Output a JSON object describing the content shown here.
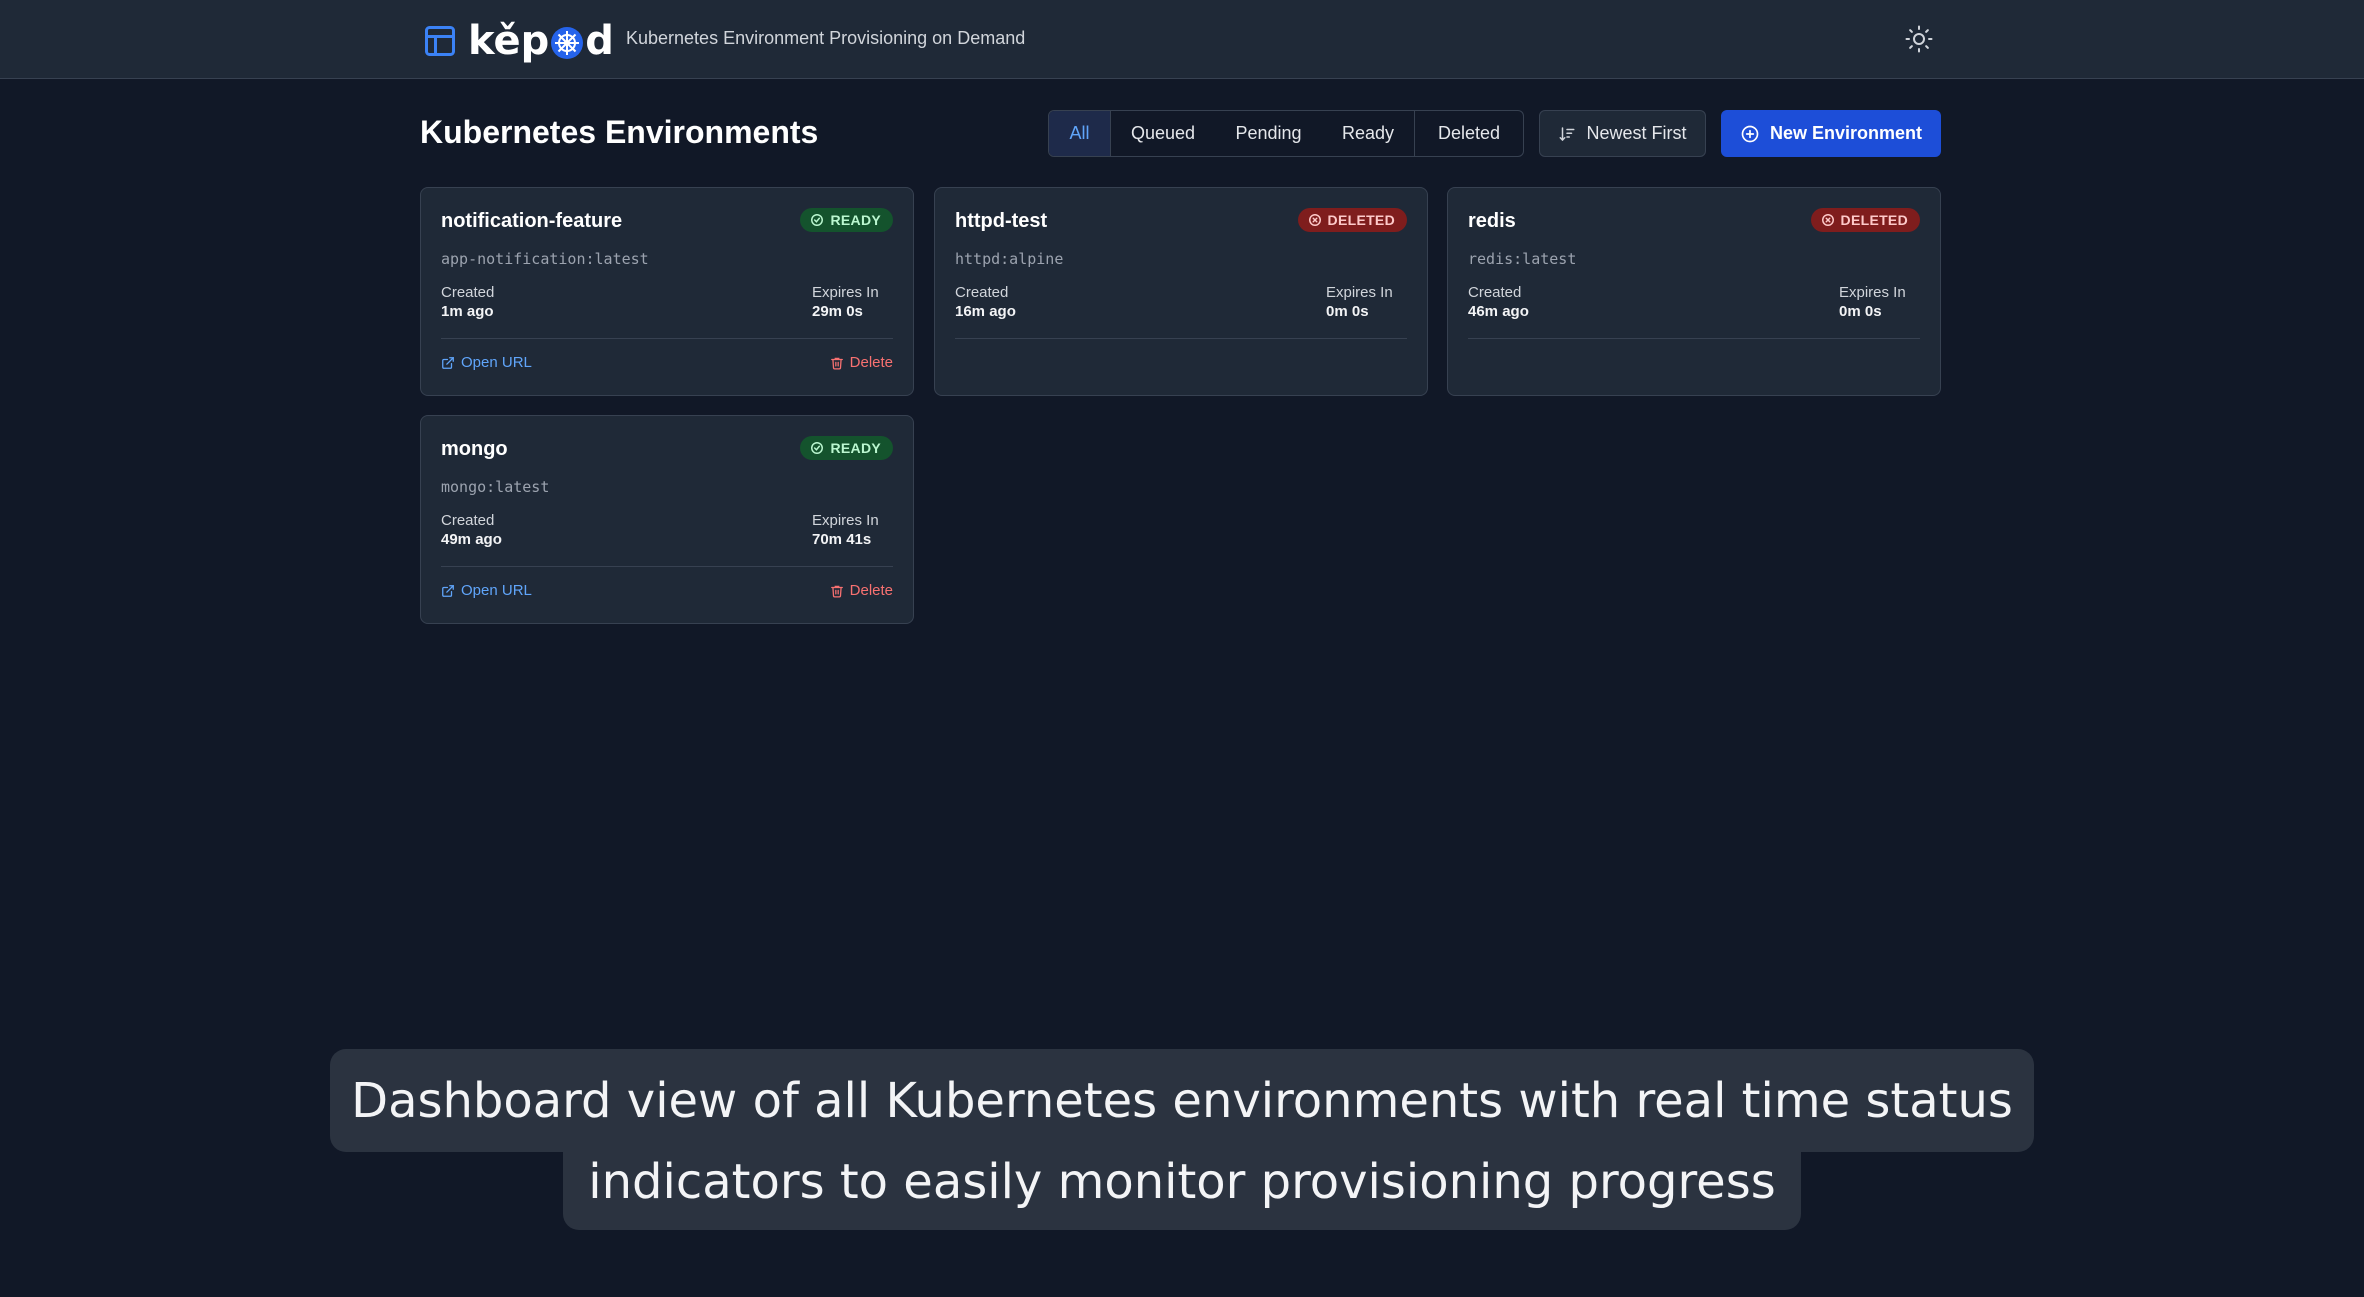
{
  "header": {
    "brand_name_start": "kěp",
    "brand_name_end": "d",
    "tagline": "Kubernetes Environment Provisioning on Demand",
    "logo_icon": "layout-icon",
    "theme_icon": "sun-icon"
  },
  "toolbar": {
    "title": "Kubernetes Environments",
    "filters": [
      {
        "label": "All",
        "active": true
      },
      {
        "label": "Queued",
        "active": false
      },
      {
        "label": "Pending",
        "active": false
      },
      {
        "label": "Ready",
        "active": false
      },
      {
        "label": "Deleted",
        "active": false
      }
    ],
    "sort_label": "Newest First",
    "new_label": "New Environment"
  },
  "labels": {
    "created": "Created",
    "expires": "Expires In",
    "open_url": "Open URL",
    "delete": "Delete"
  },
  "environments": [
    {
      "name": "notification-feature",
      "image": "app-notification:latest",
      "status": "READY",
      "created": "1m ago",
      "expires": "29m 0s"
    },
    {
      "name": "httpd-test",
      "image": "httpd:alpine",
      "status": "DELETED",
      "created": "16m ago",
      "expires": "0m 0s"
    },
    {
      "name": "redis",
      "image": "redis:latest",
      "status": "DELETED",
      "created": "46m ago",
      "expires": "0m 0s"
    },
    {
      "name": "mongo",
      "image": "mongo:latest",
      "status": "READY",
      "created": "49m ago",
      "expires": "70m 41s"
    }
  ],
  "caption": {
    "line1": "Dashboard view of all Kubernetes environments with real time status",
    "line2": "indicators to easily monitor provisioning progress"
  },
  "colors": {
    "background": "#111827",
    "surface": "#1f2937",
    "accent": "#1d4ed8",
    "link": "#60a5fa",
    "ready": "#14532d",
    "deleted": "#7f1d1d",
    "danger": "#f87171"
  }
}
